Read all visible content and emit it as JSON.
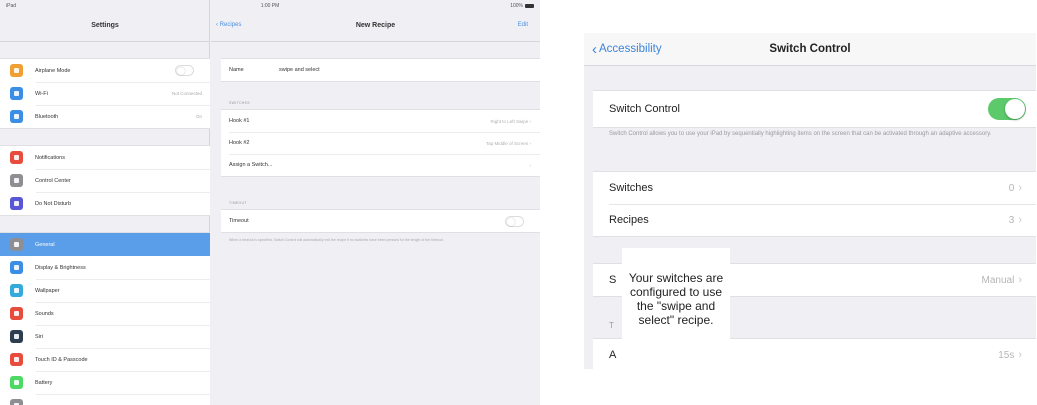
{
  "status_bar": {
    "left": "iPad",
    "time": "1:00 PM",
    "battery": "100%"
  },
  "master": {
    "title": "Settings",
    "group1": [
      {
        "label": "Airplane Mode",
        "icon": "airplane-icon",
        "color": "#f0a032",
        "toggle": true
      },
      {
        "label": "Wi-Fi",
        "icon": "wifi-icon",
        "color": "#3a8ee6",
        "value": "Not Connected"
      },
      {
        "label": "Bluetooth",
        "icon": "bluetooth-icon",
        "color": "#3a8ee6",
        "value": "On"
      }
    ],
    "group2": [
      {
        "label": "Notifications",
        "icon": "notifications-icon",
        "color": "#e74c3c"
      },
      {
        "label": "Control Center",
        "icon": "control-center-icon",
        "color": "#8e8e93"
      },
      {
        "label": "Do Not Disturb",
        "icon": "moon-icon",
        "color": "#5856d6"
      }
    ],
    "group3": [
      {
        "label": "General",
        "icon": "gear-icon",
        "color": "#8e8e93",
        "selected": true
      },
      {
        "label": "Display & Brightness",
        "icon": "brightness-icon",
        "color": "#3a8ee6"
      },
      {
        "label": "Wallpaper",
        "icon": "wallpaper-icon",
        "color": "#34aadc"
      },
      {
        "label": "Sounds",
        "icon": "speaker-icon",
        "color": "#e74c3c"
      },
      {
        "label": "Siri",
        "icon": "siri-icon",
        "color": "#2c3e50"
      },
      {
        "label": "Touch ID & Passcode",
        "icon": "fingerprint-icon",
        "color": "#e74c3c"
      },
      {
        "label": "Battery",
        "icon": "battery-icon",
        "color": "#4cd964"
      },
      {
        "label": "",
        "icon": "privacy-icon",
        "color": "#8e8e93"
      }
    ]
  },
  "detail": {
    "back_label": "Recipes",
    "title": "New Recipe",
    "edit_label": "Edit",
    "name_label": "Name",
    "name_value": "swipe and select",
    "switches_header": "SWITCHES",
    "switch_rows": [
      {
        "label": "Hook #1",
        "value": "Right to Left Swipe"
      },
      {
        "label": "Hook #2",
        "value": "Tap Middle of Screen"
      },
      {
        "label": "Assign a Switch...",
        "value": ""
      }
    ],
    "timeout_header": "TIMEOUT",
    "timeout_label": "Timeout",
    "timeout_footer": "When a timeout is specified, Switch Control will automatically exit the recipe if no switches have been pressed for the length of the timeout."
  },
  "switch_control": {
    "back_label": "Accessibility",
    "title": "Switch Control",
    "toggle_label": "Switch Control",
    "toggle_on": true,
    "description": "Switch Control allows you to use your iPad by sequentially highlighting items on the screen that can be activated through an adaptive accessory.",
    "rows": [
      {
        "label": "Switches",
        "value": "0"
      },
      {
        "label": "Recipes",
        "value": "3"
      }
    ],
    "partial_row_1": {
      "label": "S",
      "value": "Manual"
    },
    "partial_row_2": {
      "label": "T"
    },
    "partial_row_3": {
      "label": "A",
      "value": "15s"
    },
    "tooltip": "Your switches are configured to use the \"swipe and select\" recipe."
  }
}
